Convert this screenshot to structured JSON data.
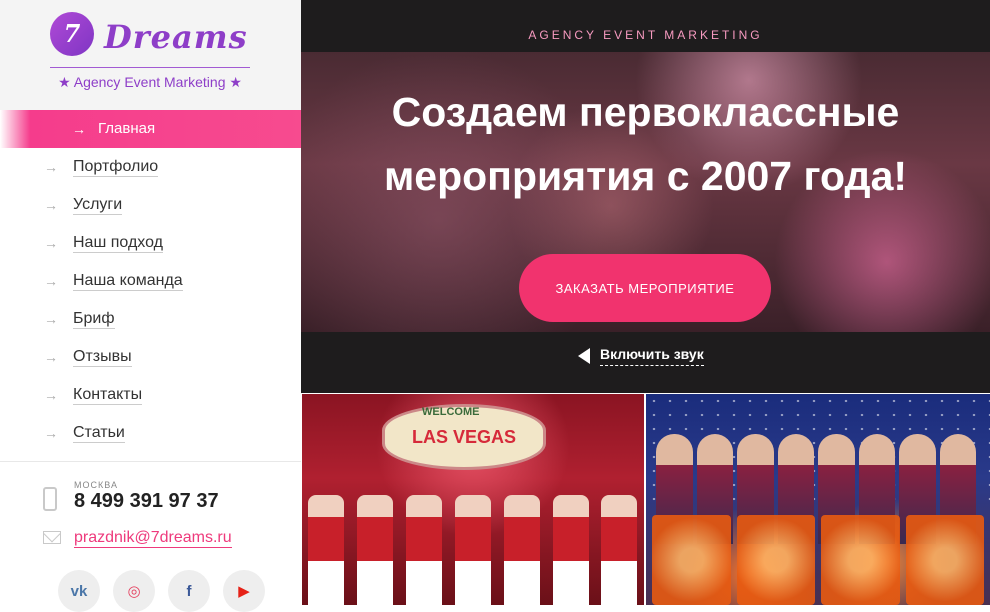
{
  "brand": {
    "logo_mark": "7",
    "logo_word": "Dreams",
    "tagline": "★ Agency Event Marketing ★"
  },
  "menu": [
    {
      "label": "Главная",
      "active": true
    },
    {
      "label": "Портфолио"
    },
    {
      "label": "Услуги"
    },
    {
      "label": "Наш подход"
    },
    {
      "label": "Наша команда"
    },
    {
      "label": "Бриф"
    },
    {
      "label": "Отзывы"
    },
    {
      "label": "Контакты"
    },
    {
      "label": "Статьи"
    }
  ],
  "contacts": {
    "city": "МОСКВА",
    "phone": "8 499 391 97 37",
    "email": "prazdnik@7dreams.ru"
  },
  "socials": [
    {
      "icon": "vk-icon",
      "glyph": "vk"
    },
    {
      "icon": "instagram-icon",
      "glyph": "◎"
    },
    {
      "icon": "facebook-icon",
      "glyph": "f"
    },
    {
      "icon": "youtube-icon",
      "glyph": "▶"
    }
  ],
  "hero": {
    "tag": "AGENCY EVENT MARKETING",
    "title_line1": "Создаем первоклассные",
    "title_line2": "мероприятия с 2007 года!",
    "cta": "ЗАКАЗАТЬ МЕРОПРИЯТИЕ",
    "sound": "Включить звук"
  },
  "tiles": {
    "vegas_welcome": "WELCOME",
    "vegas_sign": "LAS VEGAS"
  },
  "colors": {
    "accent": "#f1336e",
    "brand_purple": "#8e3ec8"
  }
}
